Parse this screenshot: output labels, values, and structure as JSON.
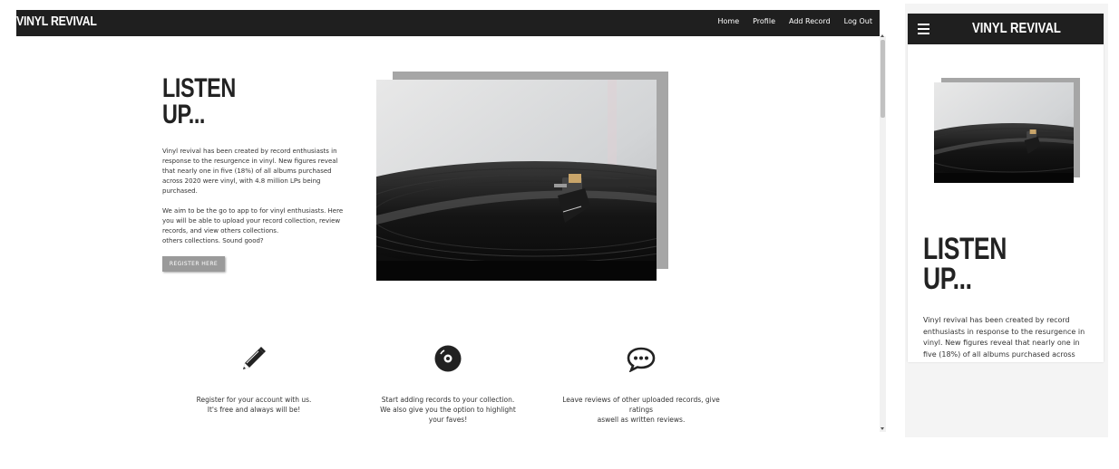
{
  "desktop": {
    "brand": "VINYL REVIVAL",
    "nav": [
      "Home",
      "Profile",
      "Add Record",
      "Log Out"
    ],
    "hero": {
      "title_line1": "LISTEN",
      "title_line2": "UP...",
      "para1": "Vinyl revival has been created by record enthusiasts in response to the resurgence in vinyl. New figures reveal that nearly one in five (18%) of all albums purchased across 2020 were vinyl, with 4.8 million LPs being purchased.",
      "para2_line1": "We aim to be the go to app to for vinyl enthusiasts. Here you will be able to upload your record collection, review records, and view others collections.",
      "para2_line2": "others collections. Sound good?",
      "register_label": "REGISTER HERE"
    },
    "features": [
      {
        "icon": "pencil-icon",
        "text_line1": "Register for your account with us.",
        "text_line2": "It's free and always will be!"
      },
      {
        "icon": "vinyl-record-icon",
        "text_line1": "Start adding records to your collection.",
        "text_line2": "We also give you the option to highlight your faves!"
      },
      {
        "icon": "speech-bubble-icon",
        "text_line1": "Leave reviews of other uploaded records, give ratings",
        "text_line2": "aswell as written reviews."
      }
    ]
  },
  "mobile": {
    "brand": "VINYL REVIVAL",
    "menu_icon": "hamburger-menu-icon",
    "title_line1": "LISTEN",
    "title_line2": "UP...",
    "para": "Vinyl revival has been created by record enthusiasts in response to the resurgence in vinyl. New figures reveal that nearly one in five (18%) of all albums purchased across"
  },
  "colors": {
    "navbar": "#1f1f1f",
    "button": "#9a9a9a",
    "photo_shadow": "#a6a6a6"
  }
}
